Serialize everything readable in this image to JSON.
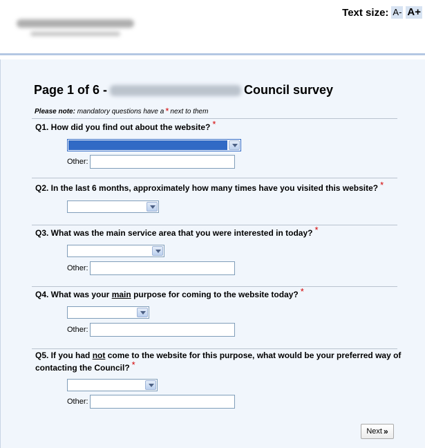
{
  "header": {
    "text_size_label": "Text size:",
    "text_smaller": "A-",
    "text_larger": "A+"
  },
  "survey": {
    "title_prefix": "Page 1 of 6 -",
    "title_suffix": "Council survey",
    "note_bold": "Please note:",
    "note_text_before": "mandatory questions have a",
    "required_mark": "*",
    "note_text_after": "next to them",
    "other_label": "Other:",
    "next_label": "Next",
    "next_glyph": "»"
  },
  "questions": [
    {
      "text": "Q1. How did you find out about the website?"
    },
    {
      "text": "Q2. In the last 6 months, approximately how many times have you visited this website?"
    },
    {
      "text": "Q3. What was the main service area that you were interested in today?"
    },
    {
      "text_before": "Q4. What was your",
      "text_underline": "main",
      "text_after": "purpose for coming to the website today?"
    },
    {
      "text_before": "Q5. If you had",
      "text_underline": "not",
      "text_after1": "come to the website for this purpose, what would be your preferred way of",
      "text_after2": "contacting the Council?"
    }
  ],
  "colors": {
    "accent_selection": "#316ac5",
    "required": "#d40000",
    "page_background": "#f1f6fc"
  }
}
